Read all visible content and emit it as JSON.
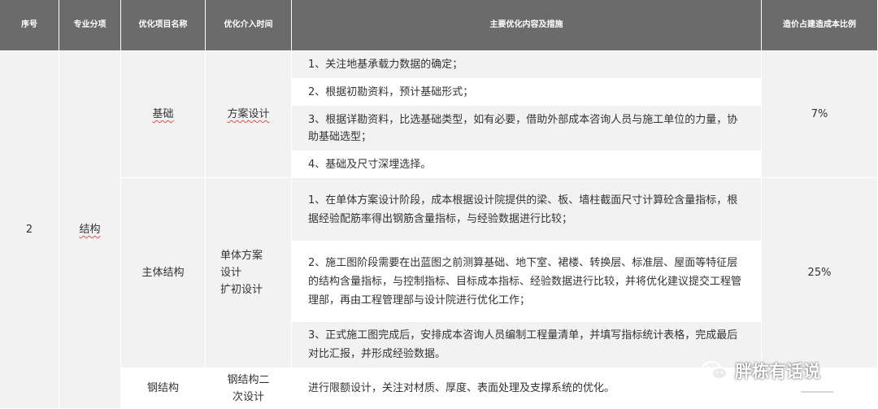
{
  "headers": {
    "index": "序号",
    "category": "专业分项",
    "item": "优化项目名称",
    "timing": "优化介入时间",
    "measures": "主要优化内容及措施",
    "ratio": "造价占建造成本比例"
  },
  "group": {
    "index": "2",
    "category": "结构"
  },
  "foundation": {
    "item": "基础",
    "timing": "方案设计",
    "ratio": "7%",
    "measures": [
      "1、关注地基承载力数据的确定；",
      "2、根据初勘资料，预计基础形式；",
      "3、根据详勘资料，比选基础类型，如有必要，借助外部成本咨询人员与施工单位的力量，协助基础选型；",
      "4、基础及尺寸深埋选择。"
    ]
  },
  "main_structure": {
    "item": "主体结构",
    "timing": [
      "单体方案",
      "设计",
      "扩初设计"
    ],
    "ratio": "25%",
    "measures": [
      "1、在单体方案设计阶段，成本根据设计院提供的梁、板、墙柱截面尺寸计算砼含量指标，根据经验配筋率得出钢筋含量指标，与经验数据进行比较；",
      "2、施工图阶段需要在出蓝图之前测算基础、地下室、裙楼、转换层、标准层、屋面等特征层的结构含量指标，与控制指标、目标成本指标、经验数据进行比较，并将优化建议提交工程管理部，再由工程管理部与设计院进行优化工作；",
      "3、正式施工图完成后，安排成本咨询人员编制工程量清单，并填写指标统计表格，完成最后对比汇报，并形成经验数据。"
    ]
  },
  "steel": {
    "item": "钢结构",
    "timing": [
      "钢结构二",
      "次设计"
    ],
    "measures": "进行限额设计，关注对材质、厚度、表面处理及支撑系统的优化。"
  },
  "watermark": {
    "text": "胖栋有话说",
    "icon": "wechat-icon"
  }
}
